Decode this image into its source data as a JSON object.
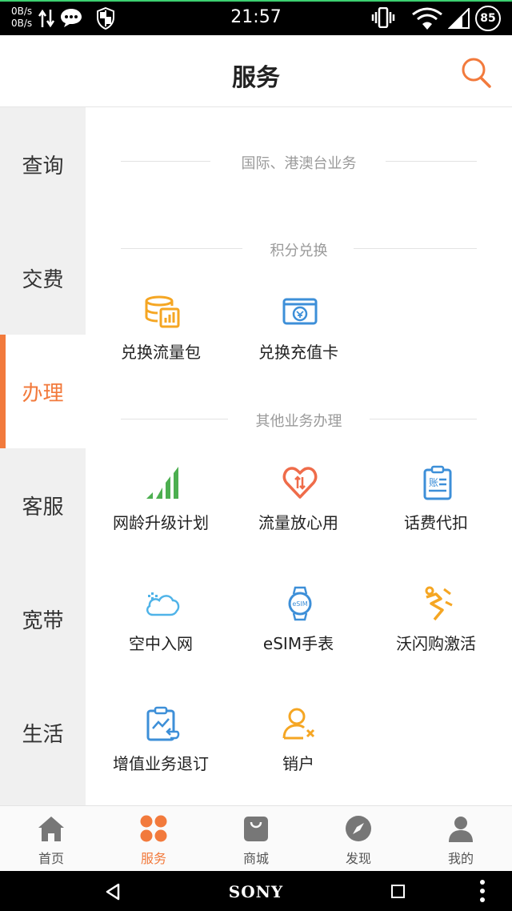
{
  "status_bar": {
    "net_up": "0B/s",
    "net_down": "0B/s",
    "time": "21:57",
    "battery": "85",
    "icons": [
      "data-arrows-icon",
      "message-icon",
      "shield-icon",
      "vibrate-icon",
      "wifi-icon",
      "signal-icon"
    ]
  },
  "header": {
    "title": "服务",
    "search_icon": "search-icon",
    "accent": "#f27a3c"
  },
  "sidebar": {
    "items": [
      {
        "label": "查询"
      },
      {
        "label": "交费"
      },
      {
        "label": "办理",
        "active": true
      },
      {
        "label": "客服"
      },
      {
        "label": "宽带"
      },
      {
        "label": "生活"
      }
    ]
  },
  "sections": {
    "intl": {
      "title": "国际、港澳台业务"
    },
    "points": {
      "title": "积分兑换",
      "items": [
        {
          "label": "兑换流量包",
          "icon": "data-package-icon"
        },
        {
          "label": "兑换充值卡",
          "icon": "recharge-card-icon"
        }
      ]
    },
    "other": {
      "title": "其他业务办理",
      "items": [
        {
          "label": "网龄升级计划",
          "icon": "signal-bars-icon"
        },
        {
          "label": "流量放心用",
          "icon": "heart-data-icon"
        },
        {
          "label": "话费代扣",
          "icon": "bill-clipboard-icon"
        },
        {
          "label": "空中入网",
          "icon": "cloud-icon"
        },
        {
          "label": "eSIM手表",
          "icon": "watch-icon"
        },
        {
          "label": "沃闪购激活",
          "icon": "lightning-icon"
        },
        {
          "label": "增值业务退订",
          "icon": "unsubscribe-icon"
        },
        {
          "label": "销户",
          "icon": "cancel-user-icon"
        }
      ]
    }
  },
  "tabbar": {
    "items": [
      {
        "label": "首页",
        "icon": "home-icon"
      },
      {
        "label": "服务",
        "icon": "grid-icon",
        "active": true
      },
      {
        "label": "商城",
        "icon": "shop-bag-icon"
      },
      {
        "label": "发现",
        "icon": "compass-icon"
      },
      {
        "label": "我的",
        "icon": "user-icon"
      }
    ]
  },
  "navbar": {
    "brand": "SONY"
  },
  "colors": {
    "accent": "#f27a3c",
    "icon_orange": "#f5a623",
    "icon_blue": "#3d8fd8",
    "icon_green": "#4caf50",
    "sidebar_bg": "#f0f0f0"
  }
}
